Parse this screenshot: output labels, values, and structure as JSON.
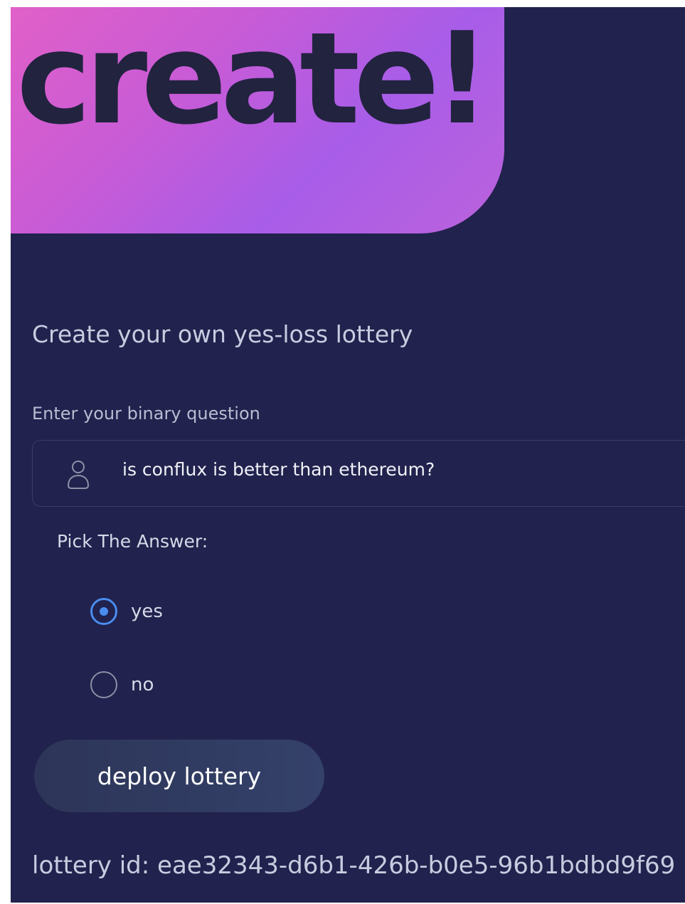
{
  "hero": {
    "title": "create!"
  },
  "form": {
    "subtitle": "Create your own yes-loss lottery",
    "question_label": "Enter your binary question",
    "question_value": "is conflux is better than ethereum?",
    "question_icon": "user-icon",
    "answer_label": "Pick The Answer:",
    "options": [
      {
        "label": "yes",
        "checked": true
      },
      {
        "label": "no",
        "checked": false
      }
    ],
    "deploy_label": "deploy lottery"
  },
  "result": {
    "lottery_id": "lottery id: eae32343-d6b1-426b-b0e5-96b1bdbd9f69"
  },
  "colors": {
    "background": "#21224d",
    "hero_gradient_start": "#e060c8",
    "hero_gradient_end": "#a85de8",
    "accent": "#4a8df0",
    "button": "#2d3558"
  }
}
